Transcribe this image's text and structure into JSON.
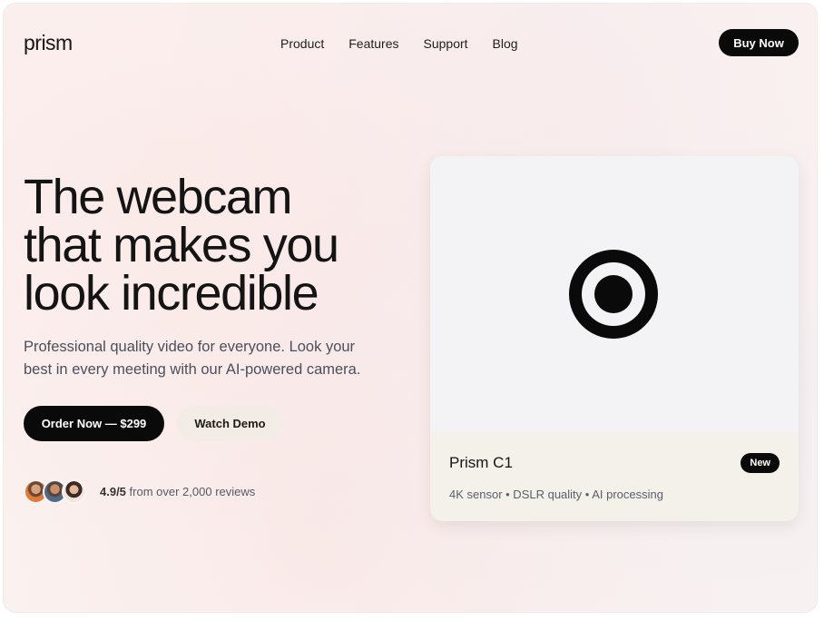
{
  "brand": {
    "logo": "prism"
  },
  "nav": {
    "items": [
      {
        "label": "Product"
      },
      {
        "label": "Features"
      },
      {
        "label": "Support"
      },
      {
        "label": "Blog"
      }
    ],
    "cta_label": "Buy Now"
  },
  "hero": {
    "headline_lines": [
      "The webcam",
      "that makes you",
      "look incredible"
    ],
    "subtitle_lines": [
      "Professional quality video for everyone. Look your",
      "best in every meeting with our AI-powered camera."
    ],
    "primary_button": "Order Now — $299",
    "secondary_button": "Watch Demo",
    "rating": {
      "score": "4.9/5",
      "text": "from over 2,000 reviews",
      "avatar_count": 3
    }
  },
  "product_card": {
    "name": "Prism C1",
    "badge": "New",
    "specs": "4K sensor • DSLR quality • AI processing",
    "icon": "camera-lens-icon"
  },
  "colors": {
    "primary": "#0a0a0a",
    "background": "#fbf3f1",
    "secondary_button": "#f3ece6",
    "card_footer": "#f4f0ea"
  }
}
